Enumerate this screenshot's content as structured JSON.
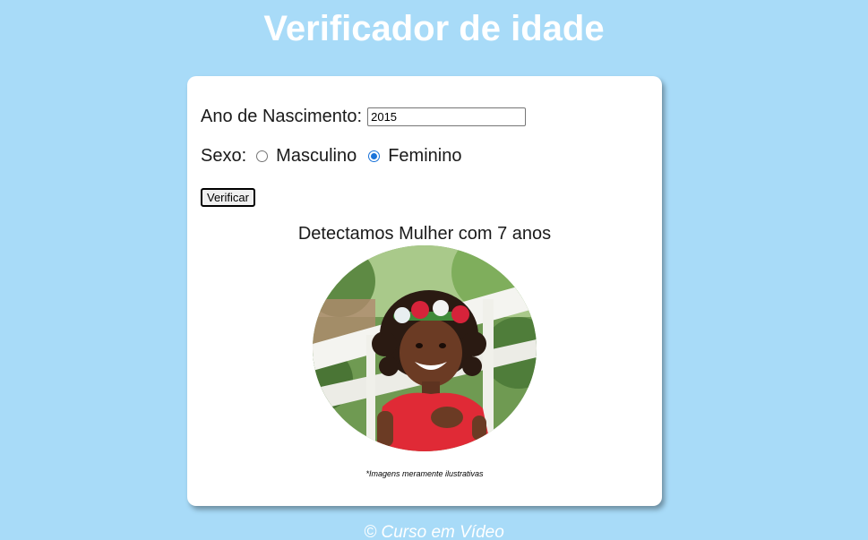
{
  "header": {
    "title": "Verificador de idade"
  },
  "form": {
    "year_label": "Ano de Nascimento:",
    "year_value": "2015",
    "sex_label": "Sexo:",
    "options": [
      {
        "label": "Masculino",
        "checked": false
      },
      {
        "label": "Feminino",
        "checked": true
      }
    ],
    "submit_label": "Verificar"
  },
  "result": {
    "text": "Detectamos Mulher com 7 anos",
    "image_subject": "photo of smiling girl with red flower crown and red dress",
    "disclaimer": "*Imagens meramente ilustrativas"
  },
  "footer": {
    "text": "© Curso em Vídeo"
  },
  "colors": {
    "background": "#a8dbf8",
    "card": "#ffffff",
    "radio_selected": "#1a73d9"
  }
}
